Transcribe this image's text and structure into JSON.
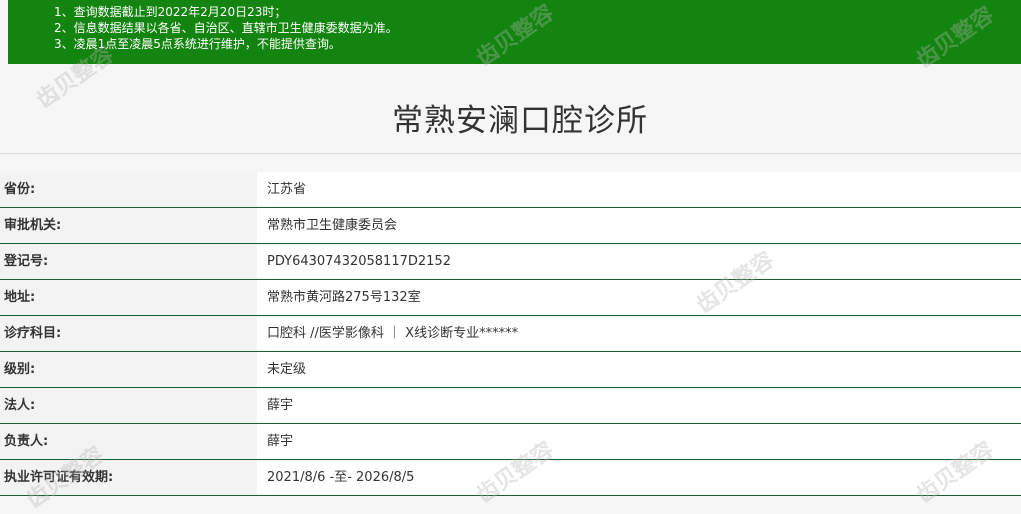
{
  "notice": {
    "lines": [
      "1、查询数据截止到2022年2月20日23时；",
      "2、信息数据结果以各省、自治区、直辖市卫生健康委数据为准。",
      "3、凌晨1点至凌晨5点系统进行维护，不能提供查询。"
    ],
    "background_color": "#13840f"
  },
  "page": {
    "title": "常熟安澜口腔诊所"
  },
  "details": [
    {
      "label": "省份:",
      "value": "江苏省"
    },
    {
      "label": "审批机关:",
      "value": "常熟市卫生健康委员会"
    },
    {
      "label": "登记号:",
      "value": "PDY64307432058117D2152"
    },
    {
      "label": "地址:",
      "value": "常熟市黄河路275号132室"
    },
    {
      "label": "诊疗科目:",
      "value": "口腔科 //医学影像科 ｜ X线诊断专业******"
    },
    {
      "label": "级别:",
      "value": "未定级"
    },
    {
      "label": "法人:",
      "value": "薛宇"
    },
    {
      "label": "负责人:",
      "value": "薛宇"
    },
    {
      "label": "执业许可证有效期:",
      "value": "2021/8/6 -至- 2026/8/5"
    }
  ],
  "watermark": {
    "text": "齿贝整容"
  },
  "colors": {
    "row_border": "#1c5e37",
    "label_background": "#f3f3f3",
    "value_background": "#ffffff"
  }
}
